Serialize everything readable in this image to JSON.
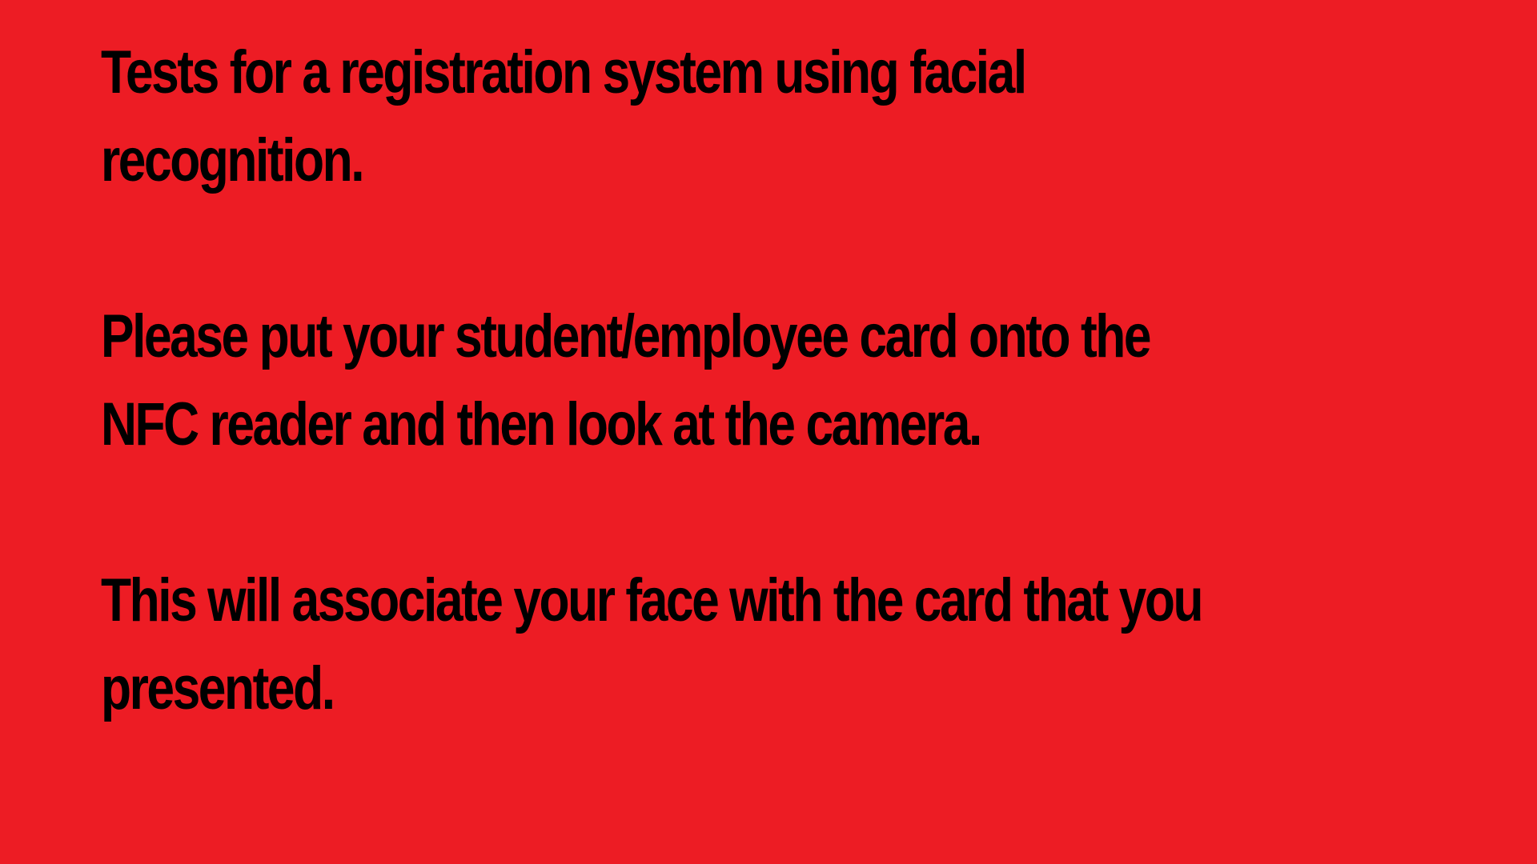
{
  "colors": {
    "background": "#ED1C24",
    "text": "#000000"
  },
  "message": {
    "title_line1": "Tests for a registration system using facial",
    "title_line2": "recognition.",
    "instruction_line1": "Please put your student/employee card onto the",
    "instruction_line2": "NFC reader and then look at the camera.",
    "info_line1": "This will associate your face with the card that you",
    "info_line2": "presented."
  }
}
